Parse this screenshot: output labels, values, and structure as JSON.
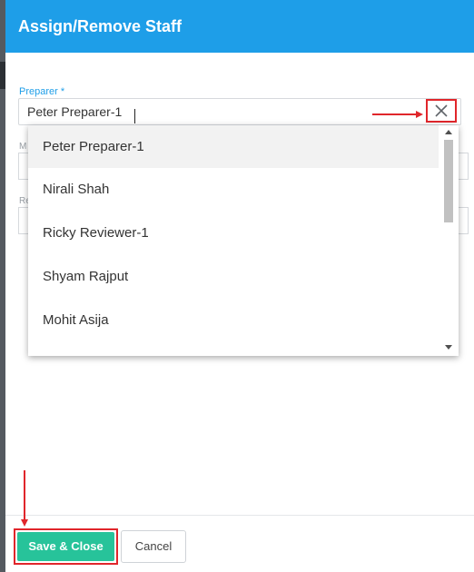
{
  "dialog": {
    "title": "Assign/Remove Staff",
    "header_color": "#1e9ee8"
  },
  "preparer": {
    "label": "Preparer *",
    "value": "Peter Preparer-1",
    "clear_icon": "close-icon"
  },
  "dropdown": {
    "options": [
      {
        "label": "Peter Preparer-1"
      },
      {
        "label": "Nirali Shah"
      },
      {
        "label": "Ricky Reviewer-1"
      },
      {
        "label": "Shyam Rajput"
      },
      {
        "label": "Mohit Asija"
      }
    ]
  },
  "footer": {
    "save_label": "Save & Close",
    "cancel_label": "Cancel",
    "save_color": "#27c39a"
  },
  "annotations": {
    "highlight_color": "#e0262b"
  }
}
